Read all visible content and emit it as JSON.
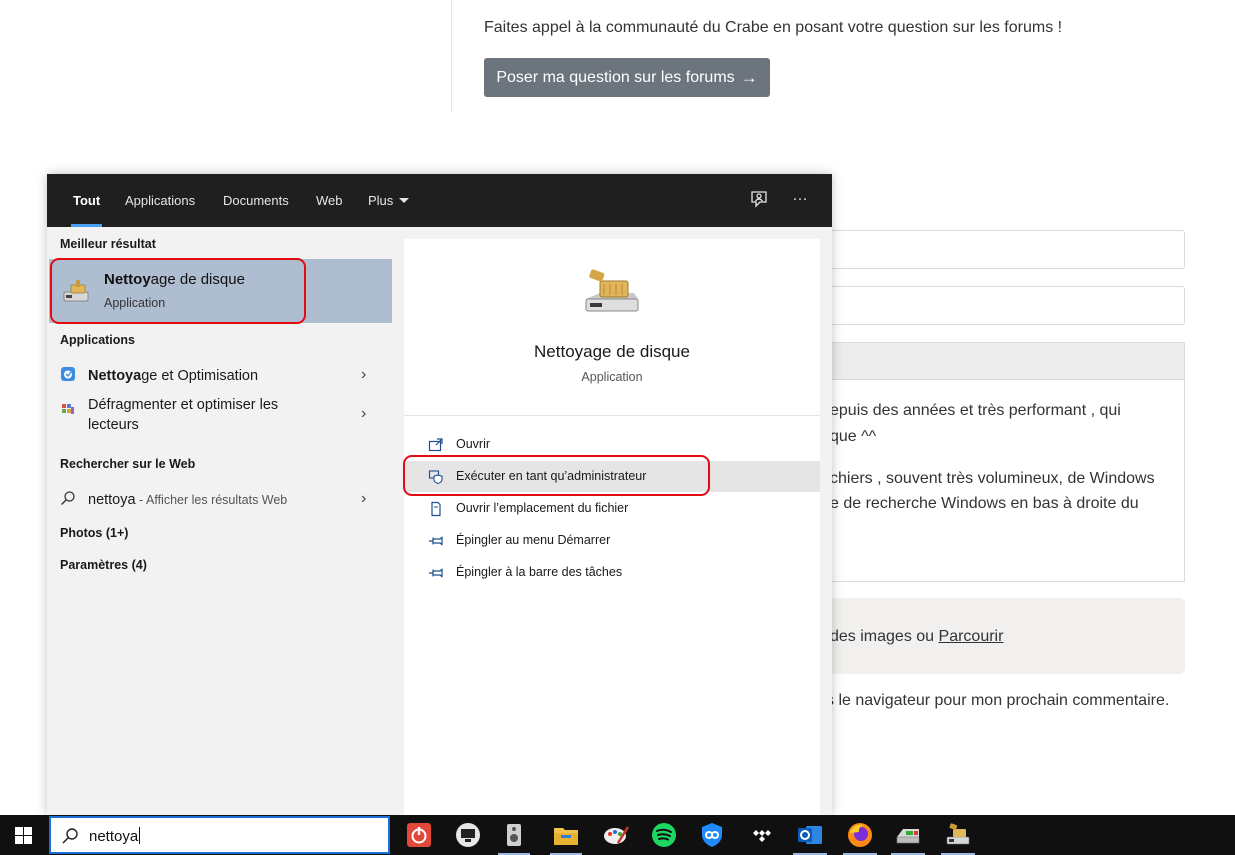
{
  "background": {
    "forum_prompt": "Faites appel à la communauté du Crabe en posant votre question sur les forums !",
    "forum_button": "Poser ma question sur les forums",
    "comment_lines": [
      "epuis des années et très performant , qui",
      "que ^^",
      "chiers , souvent très volumineux, de Windows",
      "e de recherche Windows en bas à droite du"
    ],
    "drop_text": "des images ou",
    "drop_link": "Parcourir",
    "remember_text": "s le navigateur pour mon prochain commentaire."
  },
  "nav": {
    "tabs": [
      "Tout",
      "Applications",
      "Documents",
      "Web",
      "Plus"
    ],
    "feedback_icon": "feedback-icon",
    "more_icon": "more-options-icon",
    "more_glyph": "···"
  },
  "results": {
    "best_header": "Meilleur résultat",
    "best": {
      "title_bold": "Nettoy",
      "title_rest": "age de disque",
      "subtitle": "Application"
    },
    "apps_header": "Applications",
    "apps": [
      {
        "bold": "Nettoya",
        "rest": "ge et Optimisation",
        "icon": "cleaner-app-icon"
      },
      {
        "bold": "",
        "rest": "Défragmenter et optimiser les lecteurs",
        "icon": "defrag-icon"
      }
    ],
    "web_header": "Rechercher sur le Web",
    "web_item": {
      "query": "nettoya",
      "suffix": " - Afficher les résultats Web"
    },
    "photos": "Photos (1+)",
    "params": "Paramètres (4)"
  },
  "detail": {
    "title": "Nettoyage de disque",
    "subtitle": "Application",
    "actions": [
      {
        "label": "Ouvrir",
        "icon": "open-icon"
      },
      {
        "label": "Exécuter en tant qu’administrateur",
        "icon": "shield-icon"
      },
      {
        "label": "Ouvrir l’emplacement du fichier",
        "icon": "file-location-icon"
      },
      {
        "label": "Épingler au menu Démarrer",
        "icon": "pin-icon"
      },
      {
        "label": "Épingler à la barre des tâches",
        "icon": "pin-icon"
      }
    ]
  },
  "taskbar": {
    "search_query": "nettoya",
    "apps": [
      "power-app-icon",
      "monitor-app-icon",
      "speaker-app-icon",
      "file-explorer-icon",
      "paint-app-icon",
      "spotify-icon",
      "vpn-icon",
      "tidal-icon",
      "outlook-icon",
      "firefox-icon",
      "disk-app-icon",
      "disk-cleanup-icon"
    ]
  },
  "colors": {
    "highlight": "#aebdd0",
    "annotation_red": "#e30b13",
    "nav_bg": "#1f1f1f",
    "accent": "#4a9ef5"
  }
}
